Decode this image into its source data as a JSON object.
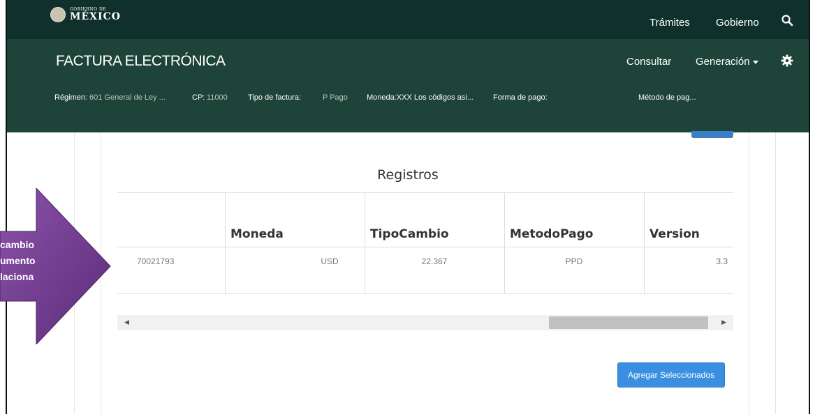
{
  "header": {
    "logo_small": "GOBIERNO DE",
    "logo_big": "MÉXICO",
    "links": {
      "tramites": "Trámites",
      "gobierno": "Gobierno"
    },
    "search_icon": "search-icon"
  },
  "app": {
    "title": "FACTURA ELECTRÓNICA",
    "nav": {
      "consultar": "Consultar",
      "generacion": "Generación"
    },
    "settings_icon": "gear-icon"
  },
  "info": {
    "regimen_label": "Régimen:",
    "regimen_value": "601 General de Ley ...",
    "cp_label": "CP:",
    "cp_value": "11000",
    "tipo_label": "Tipo de factura:",
    "tipo_value": "P Pago",
    "moneda_text": "Moneda:XXX Los códigos asi...",
    "forma_pago_label": "Forma de pago:",
    "metodo_pago_text": "Método de pag..."
  },
  "registros": {
    "title": "Registros",
    "columns": [
      "Moneda",
      "TipoCambio",
      "MetodoPago",
      "Version"
    ],
    "rows": [
      {
        "id": "70021793",
        "moneda": "USD",
        "tipocambio": "22.367",
        "metodopago": "PPD",
        "version": "3.3"
      }
    ],
    "scroll": {
      "left_arrow": "◀",
      "right_arrow": "▶"
    },
    "add_button": "Agregar Seleccionados"
  },
  "callout": {
    "lines": [
      "cambio",
      "umento",
      "laciona"
    ],
    "color": "#7a3f96"
  },
  "colors": {
    "topbar": "#10312b",
    "subbar": "#1e4338",
    "button": "#3b8fe0"
  }
}
